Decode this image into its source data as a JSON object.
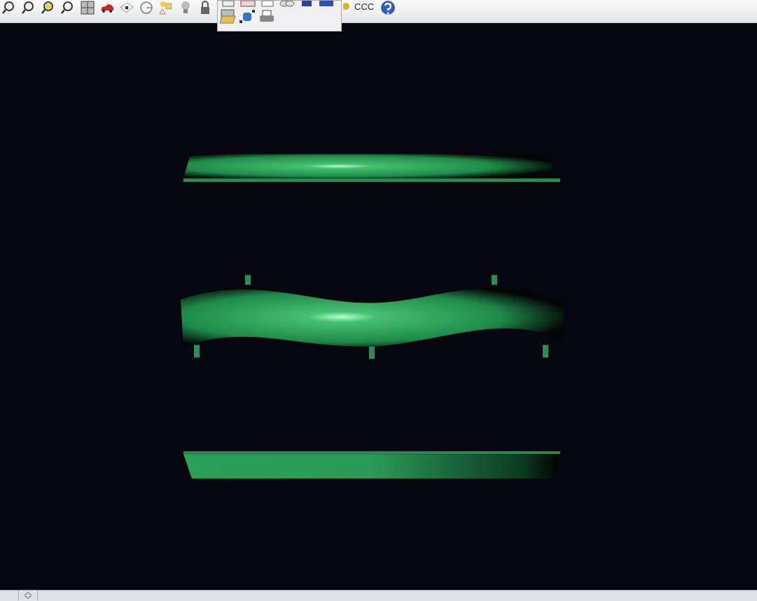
{
  "toolbar": {
    "text_button": "CCC"
  },
  "flyout": {
    "open": true
  }
}
